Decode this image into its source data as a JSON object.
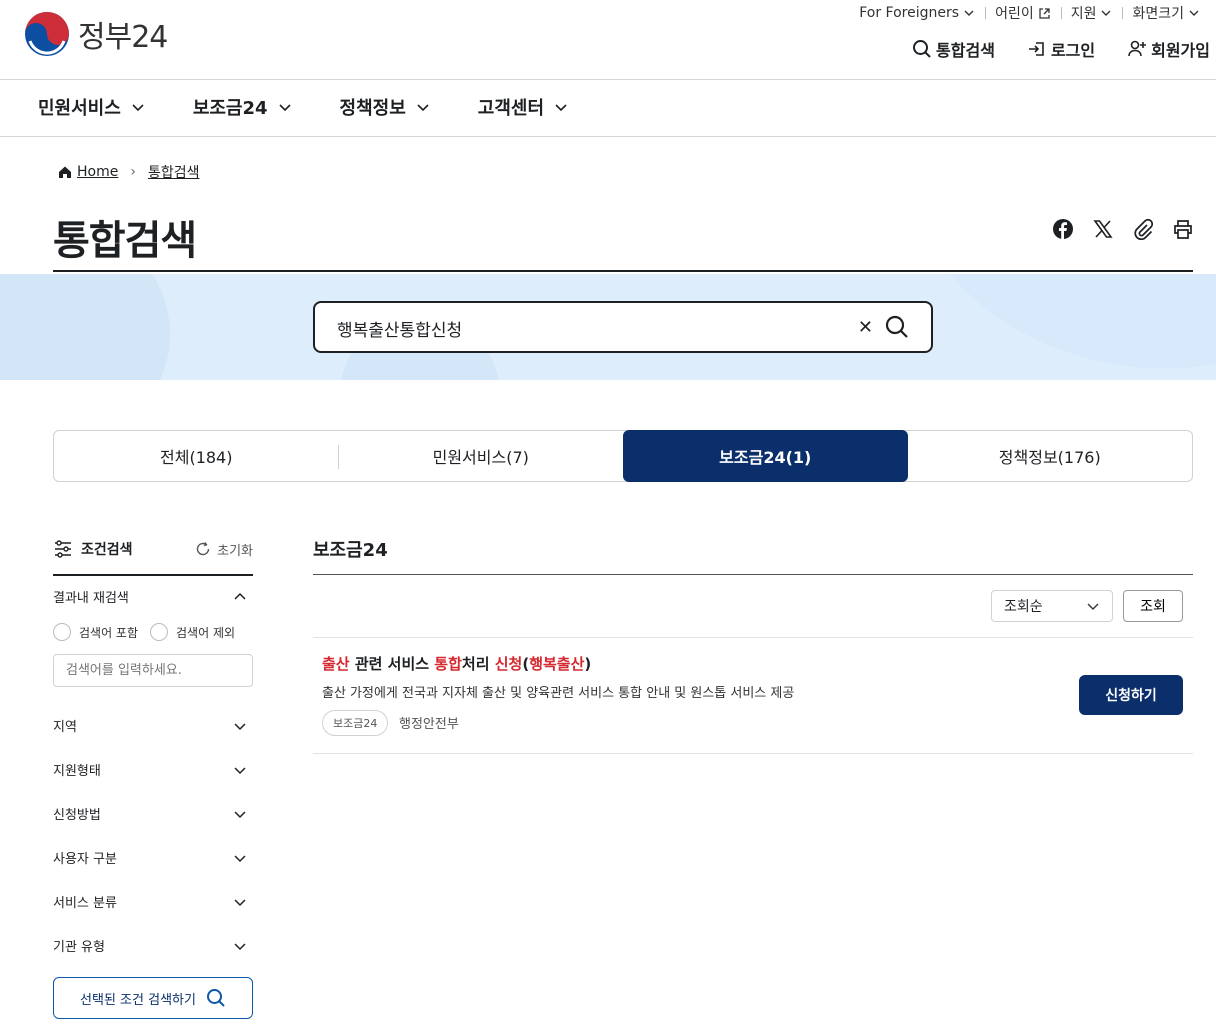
{
  "header": {
    "logo_text": "정부24",
    "util_links": [
      "For Foreigners",
      "어린이",
      "지원",
      "화면크기"
    ],
    "actions": {
      "search": "통합검색",
      "login": "로그인",
      "signup": "회원가입"
    },
    "nav": [
      "민원서비스",
      "보조금24",
      "정책정보",
      "고객센터"
    ]
  },
  "breadcrumb": {
    "home": "Home",
    "current": "통합검색"
  },
  "page_title": "통합검색",
  "search": {
    "value": "행복출산통합신청"
  },
  "tabs": [
    "전체(184)",
    "민원서비스(7)",
    "보조금24(1)",
    "정책정보(176)"
  ],
  "active_tab_index": 2,
  "sidebar": {
    "title": "조건검색",
    "reset": "초기화",
    "research_title": "결과내 재검색",
    "radio_include": "검색어 포함",
    "radio_exclude": "검색어 제외",
    "input_placeholder": "검색어를 입력하세요.",
    "filters": [
      "지역",
      "지원형태",
      "신청방법",
      "사용자 구분",
      "서비스 분류",
      "기관 유형"
    ],
    "submit": "선택된 조건 검색하기"
  },
  "results": {
    "section_title": "보조금24",
    "sort": "조회순",
    "query_button": "조회",
    "items": [
      {
        "title_parts": [
          {
            "t": "출산",
            "hl": true
          },
          {
            "t": " 관련 서비스 ",
            "hl": false
          },
          {
            "t": "통합",
            "hl": true
          },
          {
            "t": "처리 ",
            "hl": false
          },
          {
            "t": "신청",
            "hl": true
          },
          {
            "t": "(",
            "hl": false
          },
          {
            "t": "행복출산",
            "hl": true
          },
          {
            "t": ")",
            "hl": false
          }
        ],
        "desc": "출산 가정에게 전국과 지자체 출산 및 양육관련 서비스 통합 안내 및 원스톱 서비스 제공",
        "tag": "보조금24",
        "org": "행정안전부",
        "apply": "신청하기"
      }
    ]
  },
  "colors": {
    "primary": "#0b2f6b",
    "highlight": "#d5282f",
    "band": "#deedfb"
  }
}
